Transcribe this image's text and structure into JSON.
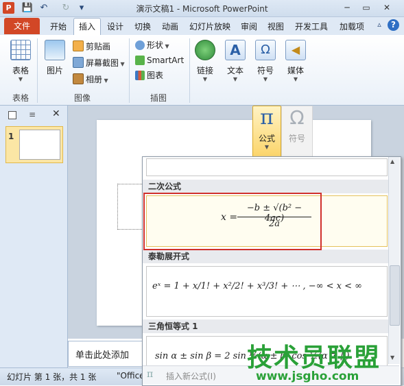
{
  "window": {
    "title": "演示文稿1 - Microsoft PowerPoint",
    "app_letter": "P"
  },
  "quick_access": {
    "save": "💾",
    "undo": "↶",
    "redo": "↻",
    "customize": "▾"
  },
  "window_buttons": {
    "minimize": "─",
    "restore": "▭",
    "close": "✕"
  },
  "tabs": {
    "file": "文件",
    "items": [
      "开始",
      "插入",
      "设计",
      "切换",
      "动画",
      "幻灯片放映",
      "审阅",
      "视图",
      "开发工具",
      "加载项"
    ],
    "active_index": 1,
    "help": "?",
    "collapse": "▵"
  },
  "ribbon": {
    "table": {
      "label": "表格",
      "group": "表格"
    },
    "images": {
      "picture": "图片",
      "clipart": "剪贴画",
      "screenshot": "屏幕截图",
      "album": "相册",
      "group": "图像"
    },
    "illustrations": {
      "shapes": "形状",
      "smartart": "SmartArt",
      "chart": "图表",
      "group": "插图"
    },
    "links": {
      "label": "链接"
    },
    "text": {
      "label": "文本"
    },
    "symbols": {
      "label": "符号"
    },
    "media": {
      "label": "媒体"
    }
  },
  "dropdown": {
    "equation": "公式",
    "symbol": "符号",
    "pi_glyph": "π",
    "omega_glyph": "Ω"
  },
  "gallery": {
    "sections": [
      {
        "title": "二次公式",
        "equation": {
          "lhs": "x = ",
          "numerator": "−b ± √(b² − 4ac)",
          "denominator": "2a"
        }
      },
      {
        "title": "泰勒展开式",
        "equation": {
          "text": "eˣ = 1 + x/1! + x²/2! + x³/3! + ⋯ ,     −∞ < x < ∞"
        }
      },
      {
        "title": "三角恒等式 1",
        "equation": {
          "text": "sin α ± sin β = 2 sin ½(α ± β) cos ½(α ∓ β)"
        }
      }
    ],
    "insert_new": "插入新公式(I)",
    "insert_icon": "π"
  },
  "left_panel": {
    "slide_number": "1"
  },
  "notes": {
    "placeholder": "单击此处添加"
  },
  "status": {
    "slide_info": "幻灯片 第 1 张，共 1 张",
    "theme": "\"Office"
  },
  "watermark": {
    "line1": "技术员联盟",
    "line2": "www.jsgho.com"
  },
  "colors": {
    "file_tab": "#d24726",
    "highlight_box": "#d0302c",
    "equation_button": "#fbd46a"
  }
}
